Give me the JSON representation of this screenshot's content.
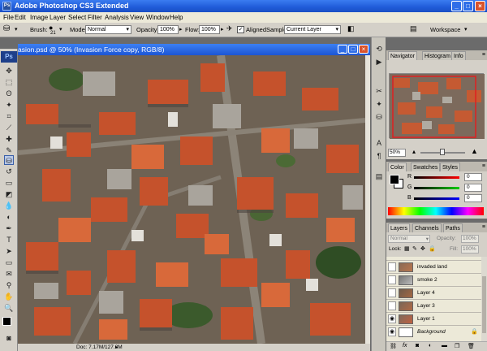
{
  "window": {
    "title": "Adobe Photoshop CS3 Extended",
    "app_logo": "Ps"
  },
  "menu": [
    "File",
    "Edit",
    "Image",
    "Layer",
    "Select",
    "Filter",
    "Analysis",
    "View",
    "Window",
    "Help"
  ],
  "options_bar": {
    "brush_label": "Brush:",
    "brush_size": "21",
    "mode_label": "Mode:",
    "mode_value": "Normal",
    "opacity_label": "Opacity:",
    "opacity_value": "100%",
    "flow_label": "Flow:",
    "flow_value": "100%",
    "aligned_label": "Aligned",
    "aligned_checked": true,
    "sample_label": "Sample:",
    "sample_value": "Current Layer",
    "workspace_label": "Workspace"
  },
  "document": {
    "title": "asion.psd @ 50% (Invasion Force copy, RGB/8)",
    "status": "Doc: 7.17M/127.8M"
  },
  "navigator": {
    "tabs": [
      "Navigator",
      "Histogram",
      "Info"
    ],
    "zoom": "50%"
  },
  "color_panel": {
    "tabs": [
      "Color",
      "Swatches",
      "Styles"
    ],
    "channels": [
      {
        "label": "R",
        "value": "0"
      },
      {
        "label": "G",
        "value": "0"
      },
      {
        "label": "B",
        "value": "0"
      }
    ]
  },
  "layers_panel": {
    "tabs": [
      "Layers",
      "Channels",
      "Paths"
    ],
    "blend_mode": "Normal",
    "opacity_label": "Opacity:",
    "opacity_value": "100%",
    "lock_label": "Lock:",
    "fill_label": "Fill:",
    "fill_value": "100%",
    "layers": [
      {
        "name": "invaded land",
        "visible": false
      },
      {
        "name": "smoke 2",
        "visible": false
      },
      {
        "name": "Layer 4",
        "visible": false
      },
      {
        "name": "Layer 3",
        "visible": false
      },
      {
        "name": "Layer 1",
        "visible": true
      },
      {
        "name": "Background",
        "visible": true
      }
    ]
  },
  "colors": {
    "titlebar": "#1f5bd8",
    "chrome": "#d4d0c8",
    "accent_red": "#d9532c"
  }
}
